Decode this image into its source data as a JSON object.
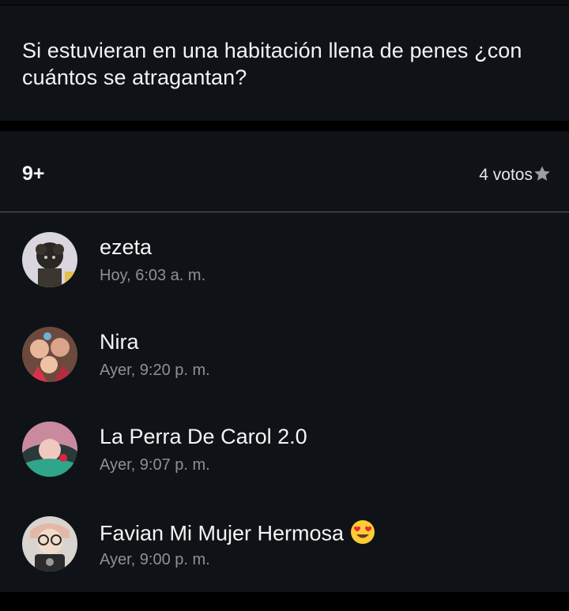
{
  "question": {
    "text": "Si estuvieran en una habitación llena de penes ¿con cuántos se atragantan?"
  },
  "option": {
    "label": "9+",
    "votes_label": "4 votos",
    "icon": "star-icon"
  },
  "voters": [
    {
      "name": "ezeta",
      "time": "Hoy, 6:03 a. m.",
      "avatar": "avatar-ezeta"
    },
    {
      "name": "Nira",
      "time": "Ayer, 9:20 p. m.",
      "avatar": "avatar-nira"
    },
    {
      "name": "La Perra De Carol 2.0",
      "time": "Ayer, 9:07 p. m.",
      "avatar": "avatar-carol"
    },
    {
      "name": "Favian Mi Mujer Hermosa",
      "time": "Ayer, 9:00 p. m.",
      "avatar": "avatar-favian",
      "emoji": "heart-eyes-emoji"
    }
  ],
  "colors": {
    "background": "#000000",
    "card": "#0f1216",
    "divider": "#5a5d62",
    "secondary_text": "#8d9096",
    "star": "#9a9da2"
  }
}
